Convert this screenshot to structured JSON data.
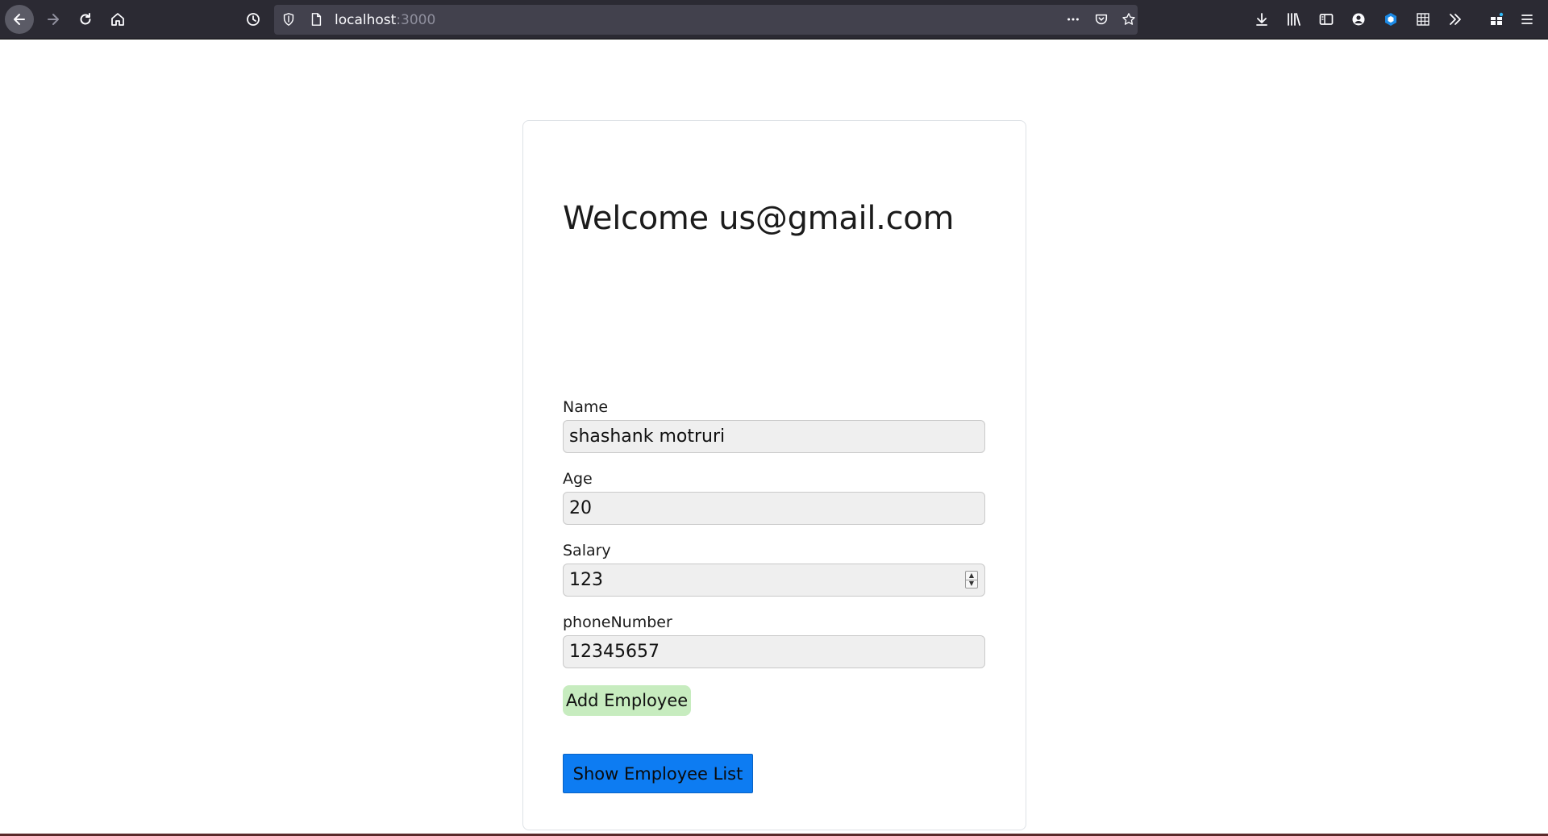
{
  "browser": {
    "url_host": "localhost",
    "url_port": ":3000",
    "icons": {
      "back": "back-arrow-icon",
      "forward": "forward-arrow-icon",
      "reload": "reload-icon",
      "home": "home-icon",
      "history": "history-clock-icon",
      "tracking": "shield-icon",
      "page": "page-icon",
      "more": "more-dots-icon",
      "pocket": "pocket-icon",
      "bookmark": "star-icon",
      "downloads": "download-icon",
      "library": "library-icon",
      "sidebar": "sidebar-icon",
      "account": "account-icon",
      "extension": "extension-icon",
      "grid": "grid-icon",
      "overflow": "chevrons-right-icon",
      "extensions": "puzzle-icon",
      "menu": "hamburger-menu-icon"
    }
  },
  "page": {
    "welcome": "Welcome us@gmail.com",
    "fields": [
      {
        "label": "Name",
        "value": "shashank motruri"
      },
      {
        "label": "Age",
        "value": "20"
      },
      {
        "label": "Salary",
        "value": "123"
      },
      {
        "label": "phoneNumber",
        "value": "12345657"
      }
    ],
    "add_button": "Add Employee",
    "show_button": "Show Employee List"
  },
  "colors": {
    "add_button_bg": "#c7ecbf",
    "show_button_bg": "#0d7cf2",
    "toolbar_bg": "#2b2a33"
  }
}
